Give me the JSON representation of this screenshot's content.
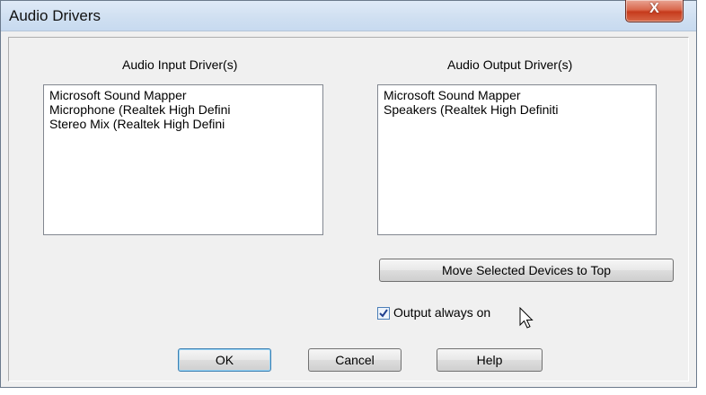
{
  "window": {
    "title": "Audio Drivers",
    "close_label": "X"
  },
  "input": {
    "label": "Audio Input Driver(s)",
    "items": [
      "Microsoft Sound Mapper",
      "Microphone (Realtek High Defini",
      "Stereo Mix (Realtek High Defini"
    ]
  },
  "output": {
    "label": "Audio Output Driver(s)",
    "items": [
      "Microsoft Sound Mapper",
      "Speakers (Realtek High Definiti"
    ]
  },
  "move_button": {
    "label": "Move Selected Devices to Top"
  },
  "output_always_on": {
    "label": "Output always on",
    "checked": true
  },
  "buttons": {
    "ok": "OK",
    "cancel": "Cancel",
    "help": "Help"
  },
  "icons": {
    "checkbox": "checkmark-icon",
    "cursor": "mouse-pointer-icon",
    "close": "close-icon"
  }
}
